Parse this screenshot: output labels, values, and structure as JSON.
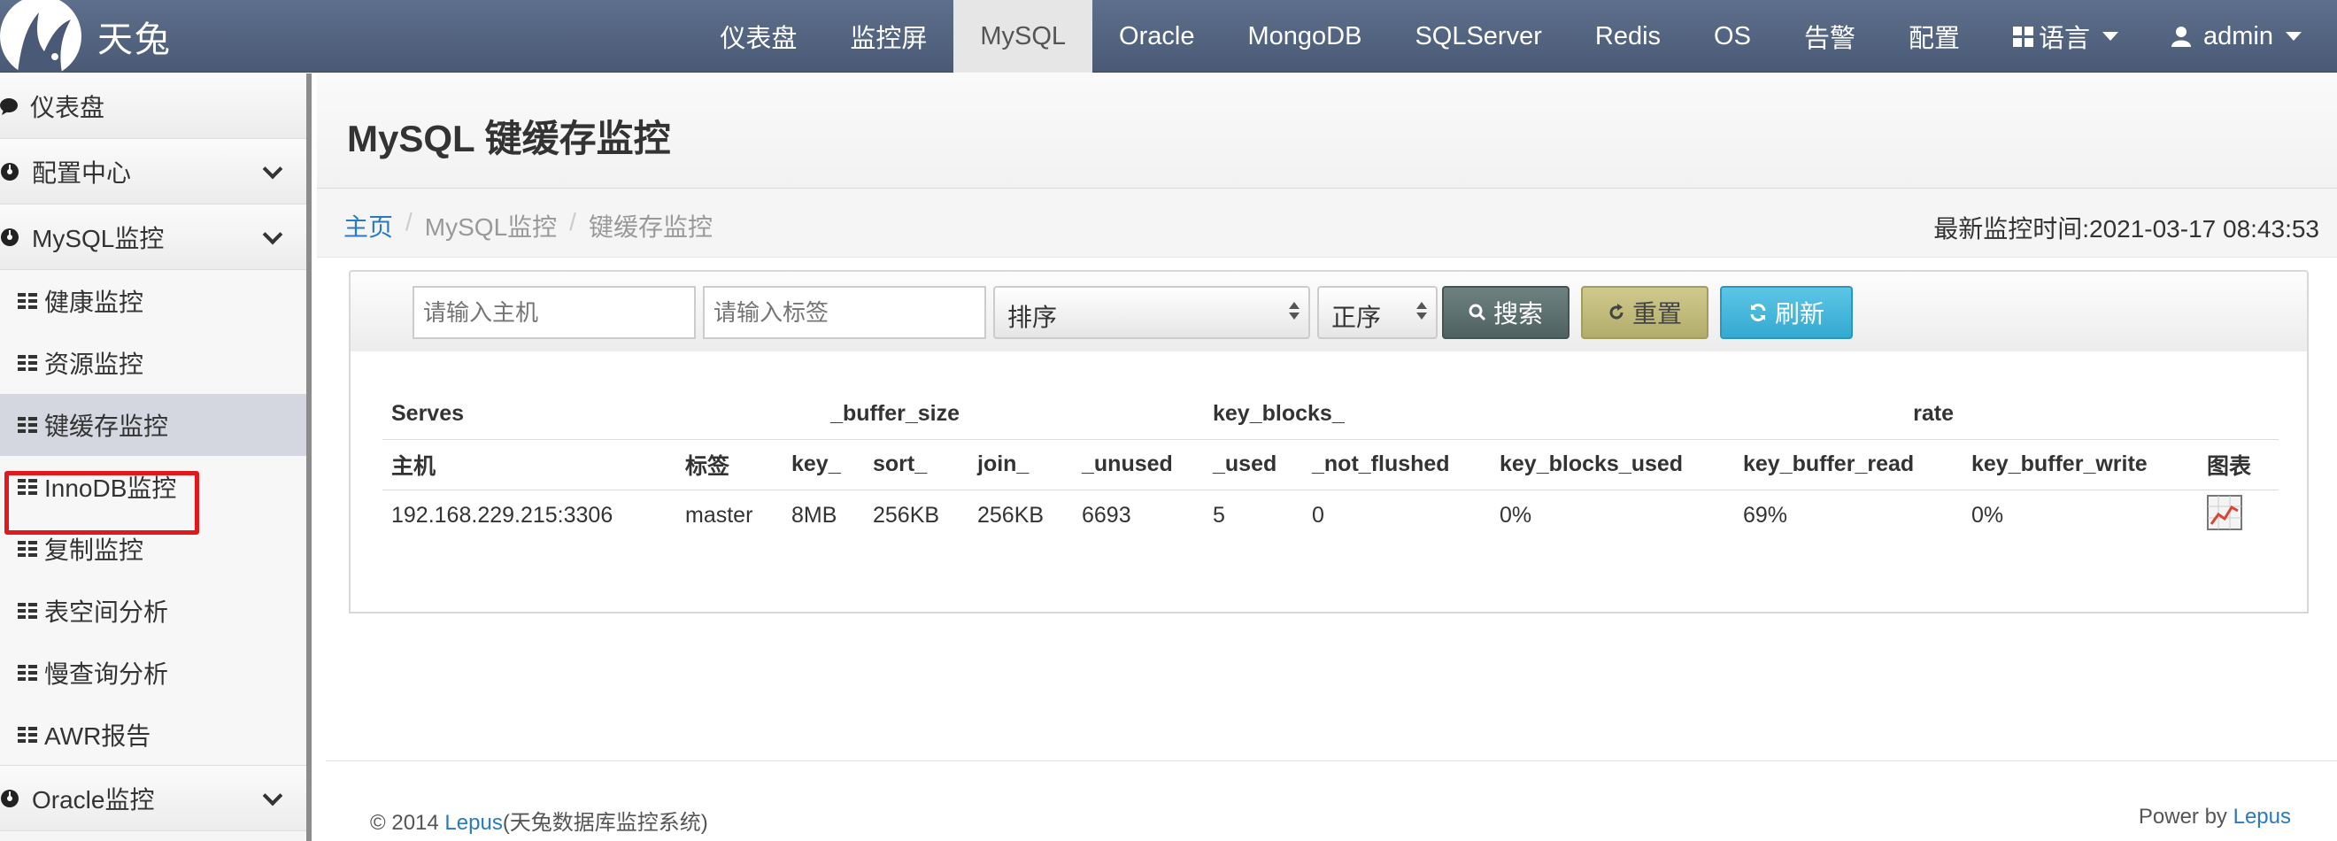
{
  "brand": {
    "name": "天兔"
  },
  "nav": {
    "items": [
      "仪表盘",
      "监控屏",
      "MySQL",
      "Oracle",
      "MongoDB",
      "SQLServer",
      "Redis",
      "OS",
      "告警",
      "配置"
    ],
    "active": "MySQL",
    "language_label": "语言",
    "user_label": "admin"
  },
  "sidebar": {
    "dashboard": "仪表盘",
    "config_center": "配置中心",
    "mysql_monitor": "MySQL监控",
    "sub_items": [
      "健康监控",
      "资源监控",
      "键缓存监控",
      "InnoDB监控",
      "复制监控",
      "表空间分析",
      "慢查询分析",
      "AWR报告"
    ],
    "selected": "键缓存监控",
    "oracle_monitor": "Oracle监控"
  },
  "page": {
    "title": "MySQL 键缓存监控",
    "breadcrumb": [
      "主页",
      "MySQL监控",
      "键缓存监控"
    ],
    "timestamp": "最新监控时间:2021-03-17 08:43:53"
  },
  "filters": {
    "host_placeholder": "请输入主机",
    "tag_placeholder": "请输入标签",
    "sort_value": "排序",
    "order_value": "正序",
    "search_label": "搜索",
    "reset_label": "重置",
    "refresh_label": "刷新"
  },
  "table": {
    "group_headers": [
      "Serves",
      "_buffer_size",
      "key_blocks_",
      "rate"
    ],
    "columns": [
      "主机",
      "标签",
      "key_",
      "sort_",
      "join_",
      "_unused",
      "_used",
      "_not_flushed",
      "key_blocks_used",
      "key_buffer_read",
      "key_buffer_write",
      "图表"
    ],
    "rows": [
      [
        "192.168.229.215:3306",
        "master",
        "8MB",
        "256KB",
        "256KB",
        "6693",
        "5",
        "0",
        "0%",
        "69%",
        "0%"
      ]
    ]
  },
  "footer": {
    "copyright": "© 2014 ",
    "brand_link": "Lepus",
    "system_name": "(天兔数据库监控系统)",
    "powered_by": "Power by ",
    "powered_link": "Lepus"
  }
}
